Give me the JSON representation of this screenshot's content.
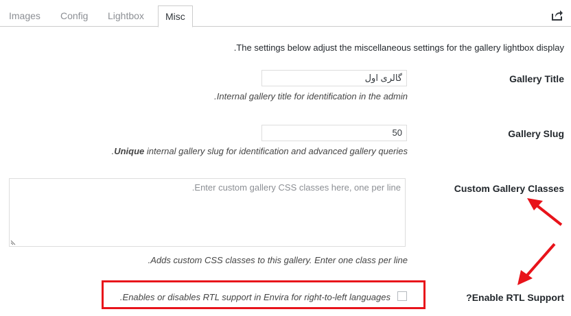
{
  "tabs": [
    {
      "label": "Images"
    },
    {
      "label": "Config"
    },
    {
      "label": "Lightbox"
    },
    {
      "label": "Misc"
    }
  ],
  "intro_text": "The settings below adjust the miscellaneous settings for the gallery lightbox display.",
  "gallery_title": {
    "label": "Gallery Title",
    "value": "گالری اول",
    "description": "Internal gallery title for identification in the admin."
  },
  "gallery_slug": {
    "label": "Gallery Slug",
    "value": "50",
    "description_bold": "Unique",
    "description": " internal gallery slug for identification and advanced gallery queries."
  },
  "custom_classes": {
    "label": "Custom Gallery Classes",
    "placeholder": "Enter custom gallery CSS classes here, one per line.",
    "description": "Adds custom CSS classes to this gallery. Enter one class per line."
  },
  "rtl_support": {
    "label": "Enable RTL Support?",
    "description": "Enables or disables RTL support in Envira for right-to-left languages.",
    "checked": false
  },
  "colors": {
    "annotation_red": "#e8131a",
    "border": "#dddddd",
    "tab_inactive": "#8c8f94"
  }
}
